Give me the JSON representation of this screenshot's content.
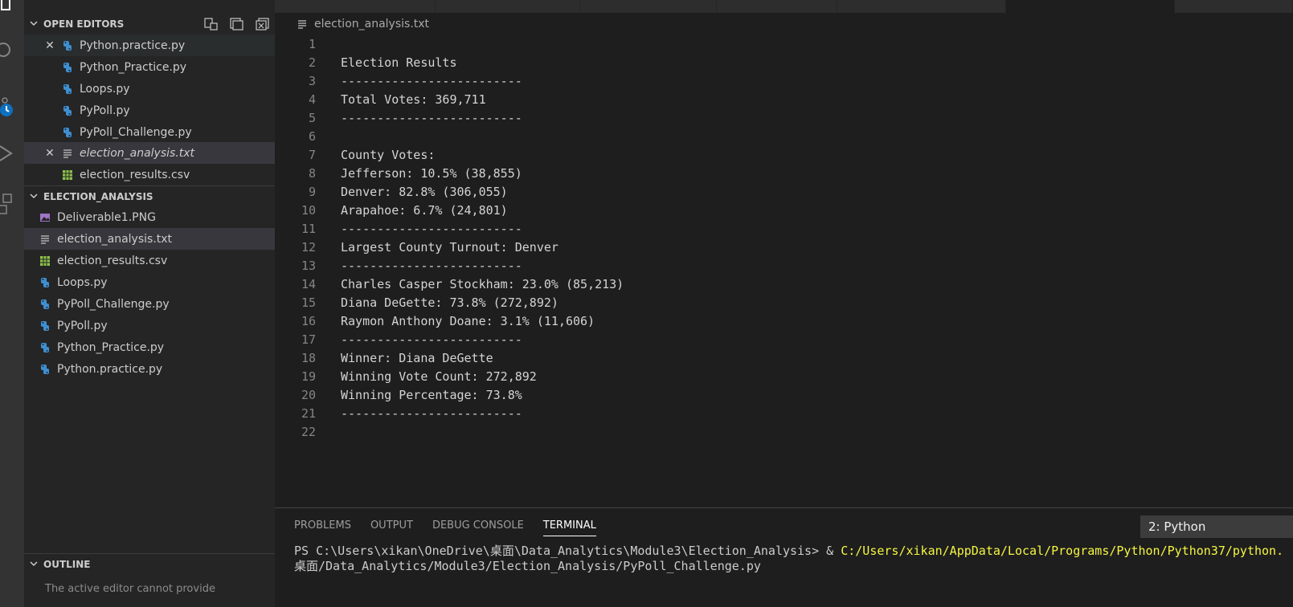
{
  "open_editors": {
    "header": "OPEN EDITORS",
    "items": [
      {
        "label": "Python.practice.py",
        "icon": "python-file-icon",
        "closable": true
      },
      {
        "label": "Python_Practice.py",
        "icon": "python-file-icon"
      },
      {
        "label": "Loops.py",
        "icon": "python-file-icon"
      },
      {
        "label": "PyPoll.py",
        "icon": "python-file-icon"
      },
      {
        "label": "PyPoll_Challenge.py",
        "icon": "python-file-icon"
      },
      {
        "label": "election_analysis.txt",
        "icon": "text-file-icon",
        "closable": true,
        "active": true
      },
      {
        "label": "election_results.csv",
        "icon": "csv-file-icon"
      }
    ]
  },
  "explorer": {
    "header": "ELECTION_ANALYSIS",
    "items": [
      {
        "label": "Deliverable1.PNG",
        "icon": "image-file-icon"
      },
      {
        "label": "election_analysis.txt",
        "icon": "text-file-icon",
        "selected": true
      },
      {
        "label": "election_results.csv",
        "icon": "csv-file-icon"
      },
      {
        "label": "Loops.py",
        "icon": "python-file-icon"
      },
      {
        "label": "PyPoll_Challenge.py",
        "icon": "python-file-icon"
      },
      {
        "label": "PyPoll.py",
        "icon": "python-file-icon"
      },
      {
        "label": "Python_Practice.py",
        "icon": "python-file-icon"
      },
      {
        "label": "Python.practice.py",
        "icon": "python-file-icon"
      }
    ]
  },
  "outline": {
    "header": "OUTLINE",
    "hint": "The active editor cannot provide"
  },
  "breadcrumb": {
    "file": "election_analysis.txt"
  },
  "editor": {
    "lines": [
      "",
      "Election Results",
      "-------------------------",
      "Total Votes: 369,711",
      "-------------------------",
      "",
      "County Votes:",
      "Jefferson: 10.5% (38,855)",
      "Denver: 82.8% (306,055)",
      "Arapahoe: 6.7% (24,801)",
      "-------------------------",
      "Largest County Turnout: Denver",
      "-------------------------",
      "Charles Casper Stockham: 23.0% (85,213)",
      "Diana DeGette: 73.8% (272,892)",
      "Raymon Anthony Doane: 3.1% (11,606)",
      "-------------------------",
      "Winner: Diana DeGette",
      "Winning Vote Count: 272,892",
      "Winning Percentage: 73.8%",
      "-------------------------",
      ""
    ]
  },
  "panel": {
    "tabs": [
      "PROBLEMS",
      "OUTPUT",
      "DEBUG CONSOLE",
      "TERMINAL"
    ],
    "active_tab": "TERMINAL",
    "terminal_select": "2: Python",
    "prompt": "PS C:\\Users\\xikan\\OneDrive\\桌面\\Data_Analytics\\Module3\\Election_Analysis> & ",
    "command_path": "C:/Users/xikan/AppData/Local/Programs/Python/Python37/python.",
    "second_line": "桌面/Data_Analytics/Module3/Election_Analysis/PyPoll_Challenge.py"
  },
  "colors": {
    "python_icon": "#3d8fd1",
    "csv_icon": "#8dc149",
    "image_icon": "#a074c4",
    "terminal_path": "#f5f543"
  }
}
